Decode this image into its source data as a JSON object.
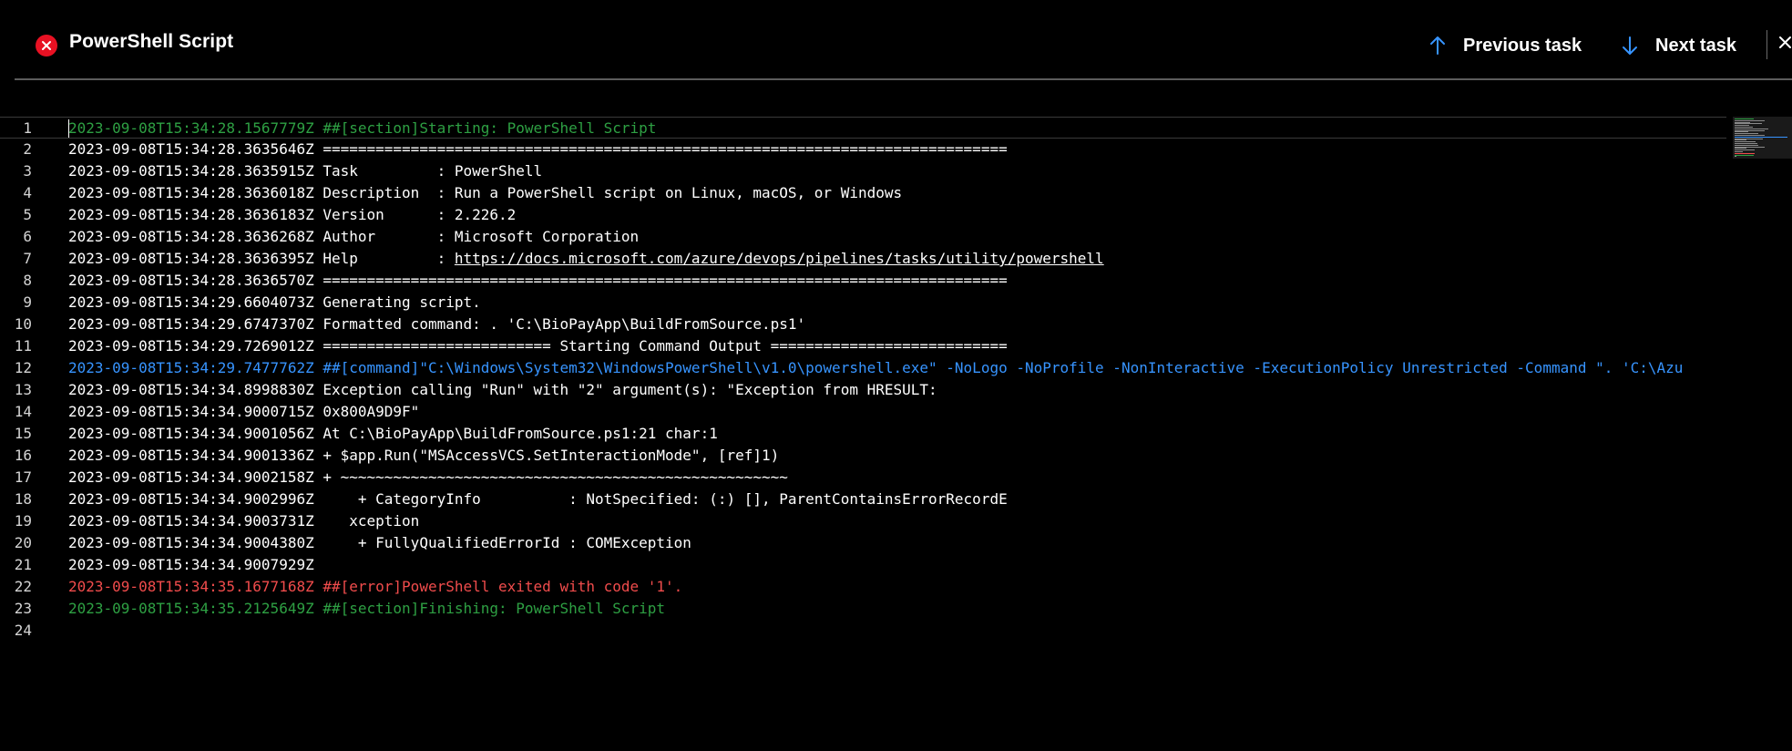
{
  "header": {
    "title": "PowerShell Script",
    "status": "failed",
    "prev_label": "Previous task",
    "next_label": "Next task",
    "colors": {
      "status_failed": "#e81123",
      "arrow": "#3794ff"
    }
  },
  "log": {
    "lines": [
      {
        "n": "1",
        "text": "2023-09-08T15:34:28.1567779Z ##[section]Starting: PowerShell Script",
        "type": "section"
      },
      {
        "n": "2",
        "text": "2023-09-08T15:34:28.3635646Z ==============================================================================",
        "type": "normal"
      },
      {
        "n": "3",
        "text": "2023-09-08T15:34:28.3635915Z Task         : PowerShell",
        "type": "normal"
      },
      {
        "n": "4",
        "text": "2023-09-08T15:34:28.3636018Z Description  : Run a PowerShell script on Linux, macOS, or Windows",
        "type": "normal"
      },
      {
        "n": "5",
        "text": "2023-09-08T15:34:28.3636183Z Version      : 2.226.2",
        "type": "normal"
      },
      {
        "n": "6",
        "text": "2023-09-08T15:34:28.3636268Z Author       : Microsoft Corporation",
        "type": "normal"
      },
      {
        "n": "7",
        "prefix": "2023-09-08T15:34:28.3636395Z Help         : ",
        "link": "https://docs.microsoft.com/azure/devops/pipelines/tasks/utility/powershell",
        "type": "link"
      },
      {
        "n": "8",
        "text": "2023-09-08T15:34:28.3636570Z ==============================================================================",
        "type": "normal"
      },
      {
        "n": "9",
        "text": "2023-09-08T15:34:29.6604073Z Generating script.",
        "type": "normal"
      },
      {
        "n": "10",
        "text": "2023-09-08T15:34:29.6747370Z Formatted command: . 'C:\\BioPayApp\\BuildFromSource.ps1'",
        "type": "normal"
      },
      {
        "n": "11",
        "text": "2023-09-08T15:34:29.7269012Z ========================== Starting Command Output ===========================",
        "type": "normal"
      },
      {
        "n": "12",
        "text": "2023-09-08T15:34:29.7477762Z ##[command]\"C:\\Windows\\System32\\WindowsPowerShell\\v1.0\\powershell.exe\" -NoLogo -NoProfile -NonInteractive -ExecutionPolicy Unrestricted -Command \". 'C:\\Azu",
        "type": "command"
      },
      {
        "n": "13",
        "text": "2023-09-08T15:34:34.8998830Z Exception calling \"Run\" with \"2\" argument(s): \"Exception from HRESULT:",
        "type": "normal"
      },
      {
        "n": "14",
        "text": "2023-09-08T15:34:34.9000715Z 0x800A9D9F\"",
        "type": "normal"
      },
      {
        "n": "15",
        "text": "2023-09-08T15:34:34.9001056Z At C:\\BioPayApp\\BuildFromSource.ps1:21 char:1",
        "type": "normal"
      },
      {
        "n": "16",
        "text": "2023-09-08T15:34:34.9001336Z + $app.Run(\"MSAccessVCS.SetInteractionMode\", [ref]1)",
        "type": "normal"
      },
      {
        "n": "17",
        "text": "2023-09-08T15:34:34.9002158Z + ~~~~~~~~~~~~~~~~~~~~~~~~~~~~~~~~~~~~~~~~~~~~~~~~~~~",
        "type": "normal"
      },
      {
        "n": "18",
        "text": "2023-09-08T15:34:34.9002996Z     + CategoryInfo          : NotSpecified: (:) [], ParentContainsErrorRecordE",
        "type": "normal"
      },
      {
        "n": "19",
        "text": "2023-09-08T15:34:34.9003731Z    xception",
        "type": "normal"
      },
      {
        "n": "20",
        "text": "2023-09-08T15:34:34.9004380Z     + FullyQualifiedErrorId : COMException",
        "type": "normal"
      },
      {
        "n": "21",
        "text": "2023-09-08T15:34:34.9007929Z",
        "type": "normal"
      },
      {
        "n": "22",
        "text": "2023-09-08T15:34:35.1677168Z ##[error]PowerShell exited with code '1'.",
        "type": "error"
      },
      {
        "n": "23",
        "text": "2023-09-08T15:34:35.2125649Z ##[section]Finishing: PowerShell Script",
        "type": "section"
      },
      {
        "n": "24",
        "text": "",
        "type": "normal"
      }
    ]
  }
}
